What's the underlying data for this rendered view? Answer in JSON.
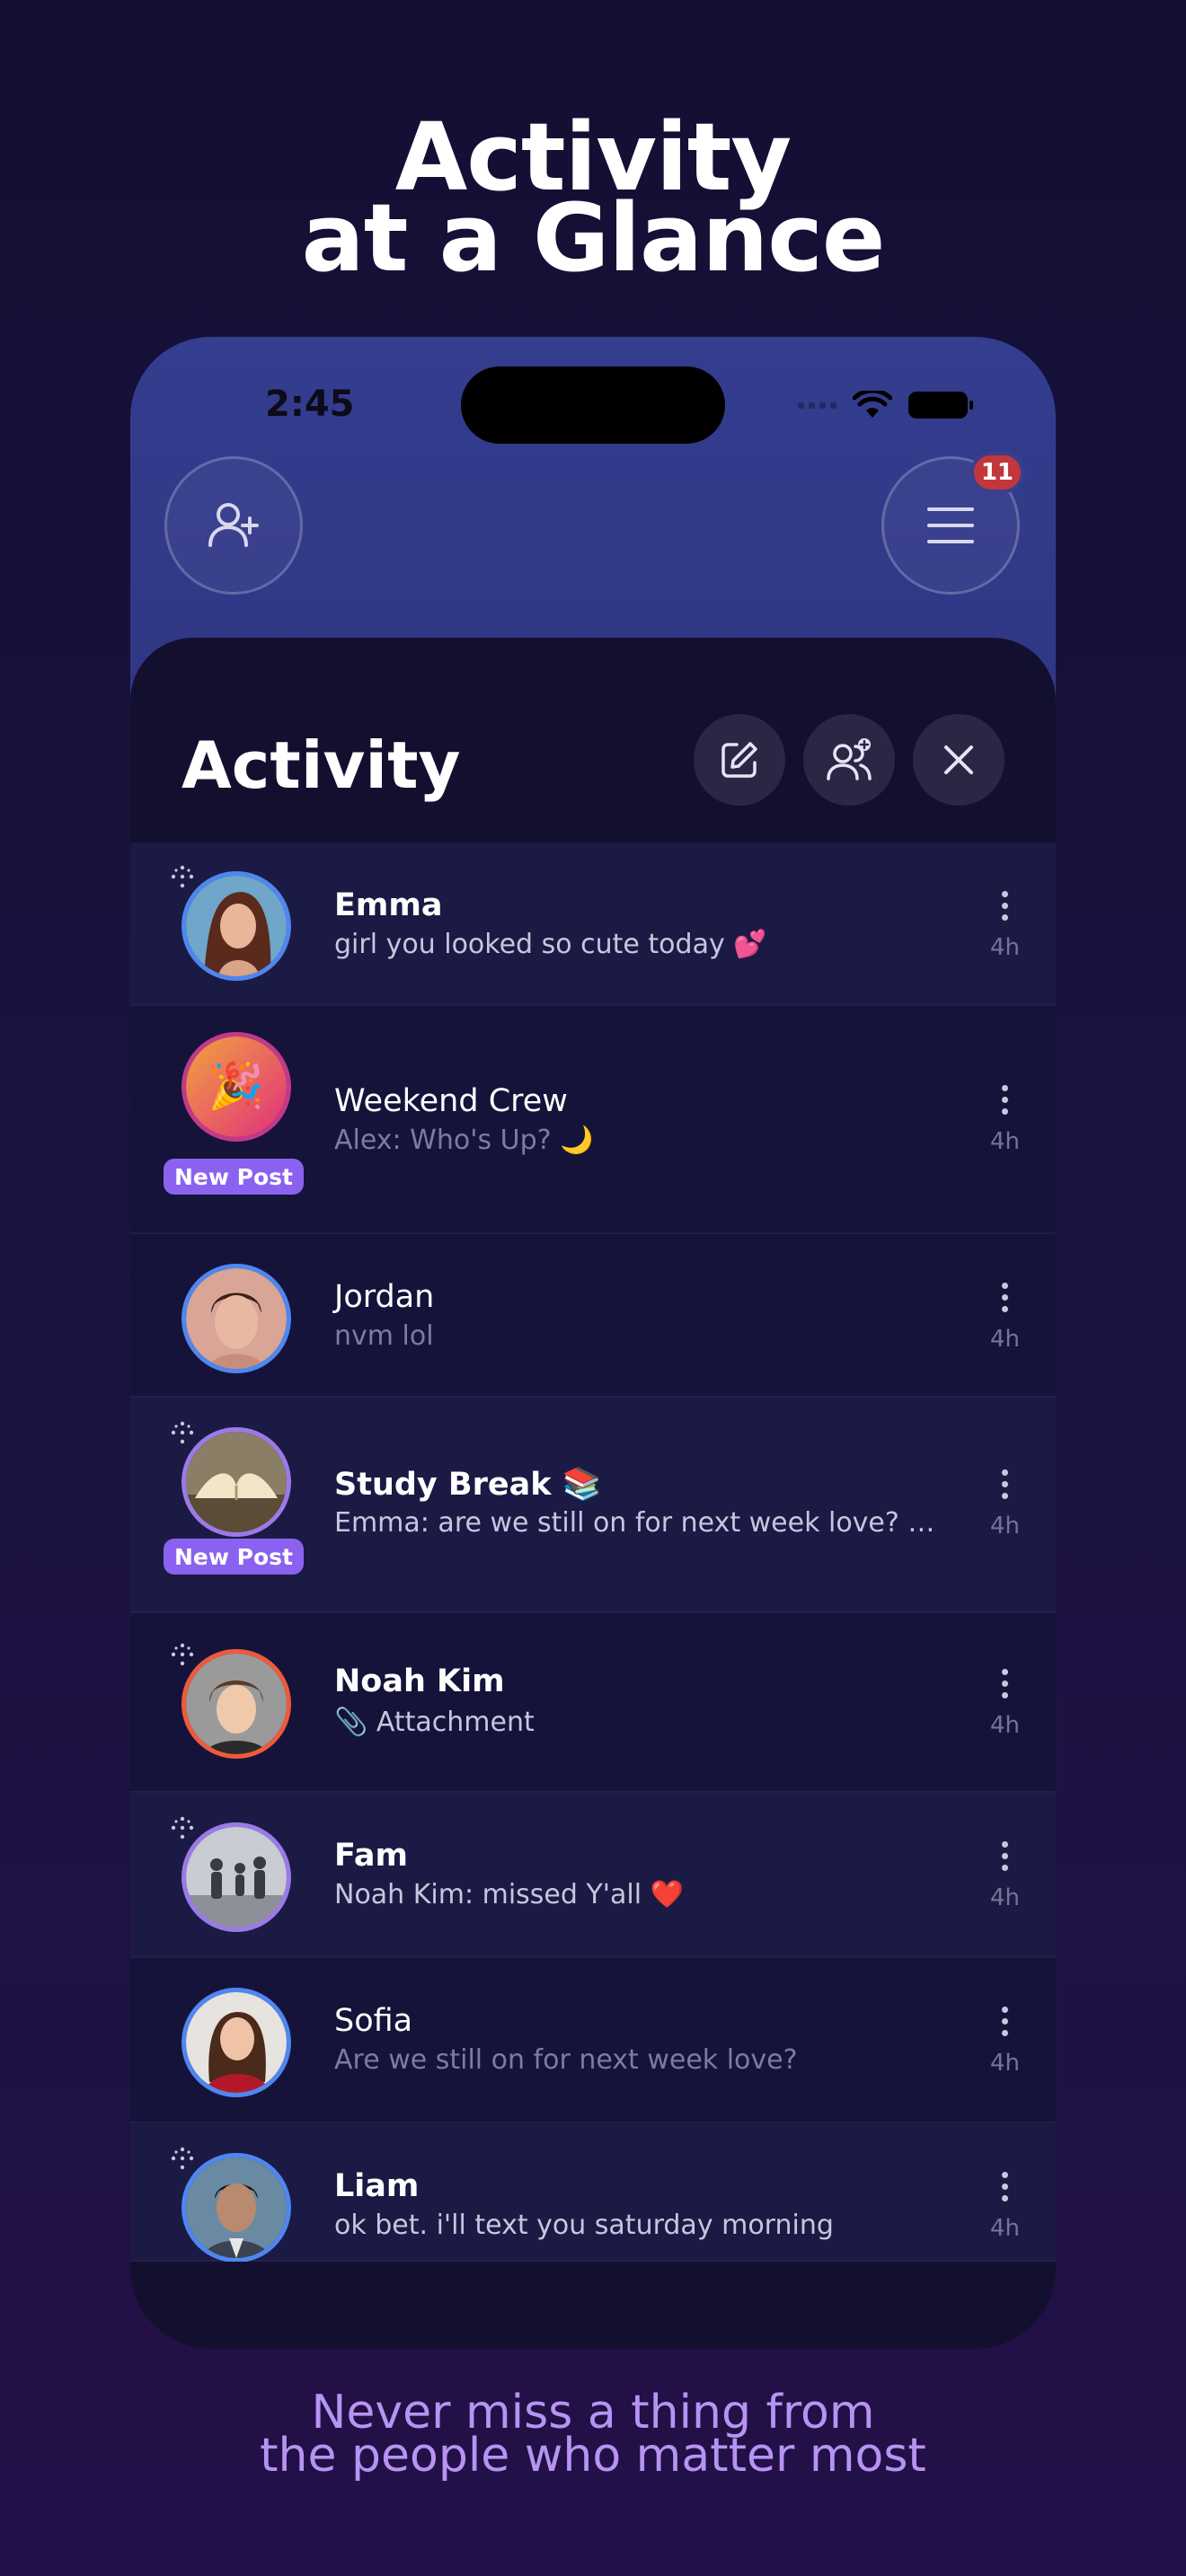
{
  "headline": {
    "line1": "Activity",
    "line2": "at a Glance"
  },
  "tagline": {
    "line1": "Never miss a thing from",
    "line2": "the people who matter most"
  },
  "status_bar": {
    "time": "2:45"
  },
  "top_bar": {
    "notification_count": "11"
  },
  "sheet": {
    "title": "Activity"
  },
  "rows": [
    {
      "name": "Emma",
      "message": "girl you looked so cute today 💕",
      "time": "4h",
      "unread": true,
      "new_post": false,
      "ring_color": "#4f86f0"
    },
    {
      "name": "Weekend Crew",
      "message": "Alex: Who's Up? 🌙",
      "time": "4h",
      "unread": false,
      "new_post": true,
      "ring_color": "#c13a8a",
      "avatar_glyph": "🎉"
    },
    {
      "name": "Jordan",
      "message": "nvm lol",
      "time": "4h",
      "unread": false,
      "new_post": false,
      "ring_color": "#4f86f0"
    },
    {
      "name": "Study Break 📚",
      "message": "Emma: are we still on for next week love? 😊 😊 ...",
      "time": "4h",
      "unread": true,
      "new_post": true,
      "ring_color": "#9b7ae8"
    },
    {
      "name": "Noah Kim",
      "message": "📎 Attachment",
      "time": "4h",
      "unread": true,
      "new_post": false,
      "ring_color": "#ee5a3c"
    },
    {
      "name": "Fam",
      "message": "Noah Kim: missed Y'all ❤️",
      "time": "4h",
      "unread": true,
      "new_post": false,
      "ring_color": "#9b7ae8"
    },
    {
      "name": "Sofia",
      "message": "Are we still on for next week love?",
      "time": "4h",
      "unread": false,
      "new_post": false,
      "ring_color": "#4f86f0"
    },
    {
      "name": "Liam",
      "message": "ok bet. i'll text you saturday morning",
      "time": "4h",
      "unread": true,
      "new_post": false,
      "ring_color": "#4f86f0"
    }
  ],
  "new_post_label": "New Post",
  "icons": {
    "add_friend": "add-user-icon",
    "menu": "hamburger-menu-icon",
    "compose": "compose-icon",
    "group_add": "add-group-icon",
    "close": "close-icon",
    "more": "kebab-icon"
  },
  "colors": {
    "accent": "#8b62f0",
    "badge": "#c2373b",
    "tagline": "#b793f2"
  }
}
